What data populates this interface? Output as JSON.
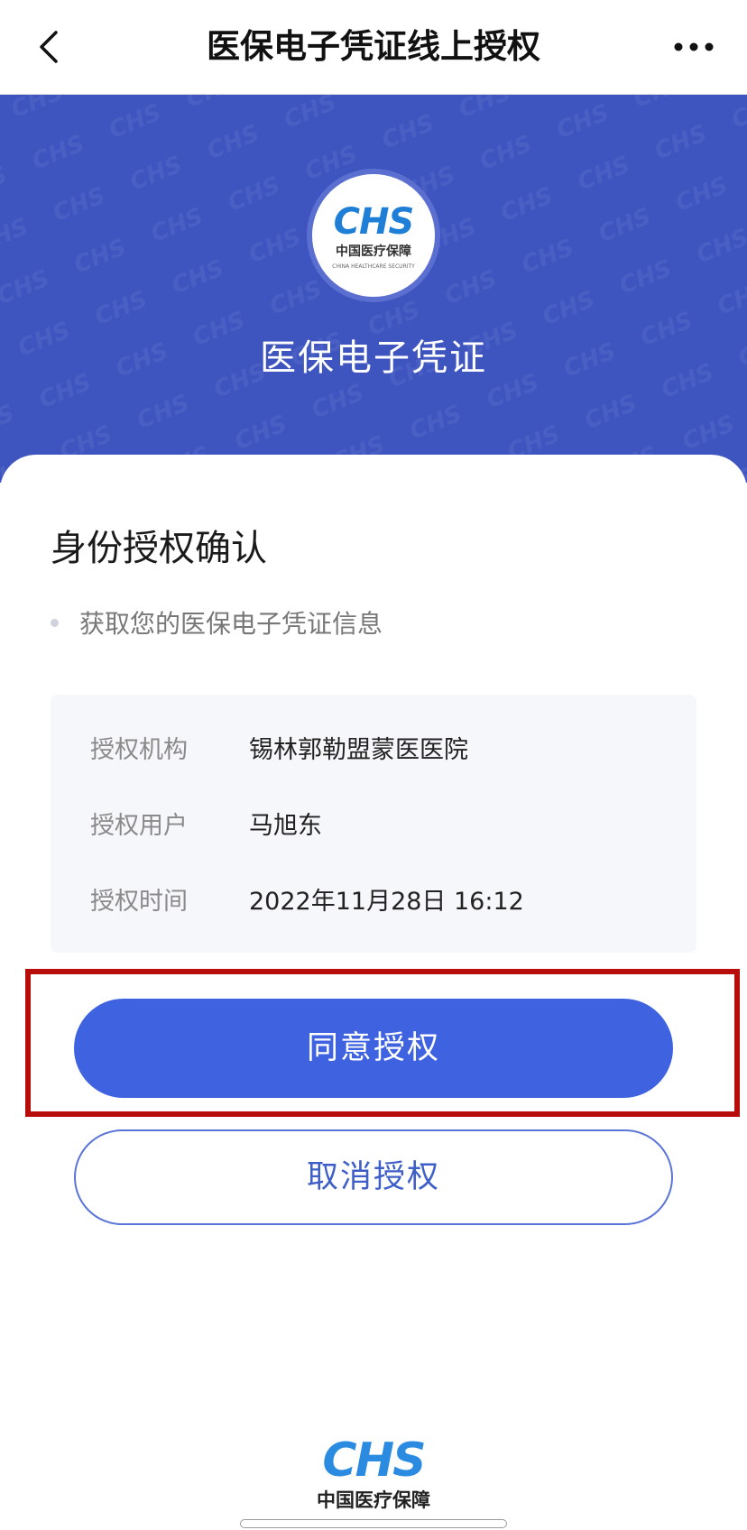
{
  "nav": {
    "title": "医保电子凭证线上授权"
  },
  "hero": {
    "logo_mark": "CHS",
    "logo_cn": "中国医疗保障",
    "logo_en": "CHINA HEALTHCARE SECURITY",
    "title": "医保电子凭证",
    "background_color": "#3e55c0"
  },
  "card": {
    "section_title": "身份授权确认",
    "bullet": "获取您的医保电子凭证信息",
    "info": [
      {
        "label": "授权机构",
        "value": "锡林郭勒盟蒙医医院"
      },
      {
        "label": "授权用户",
        "value": "马旭东"
      },
      {
        "label": "授权时间",
        "value": "2022年11月28日 16:12"
      }
    ]
  },
  "actions": {
    "agree_label": "同意授权",
    "cancel_label": "取消授权",
    "primary_color": "#3f63e0",
    "highlight_color": "#b80d0d"
  },
  "footer": {
    "logo_mark": "CHS",
    "logo_cn": "中国医疗保障"
  },
  "icons": {
    "back": "chevron-left-icon",
    "more": "more-horizontal-icon"
  }
}
